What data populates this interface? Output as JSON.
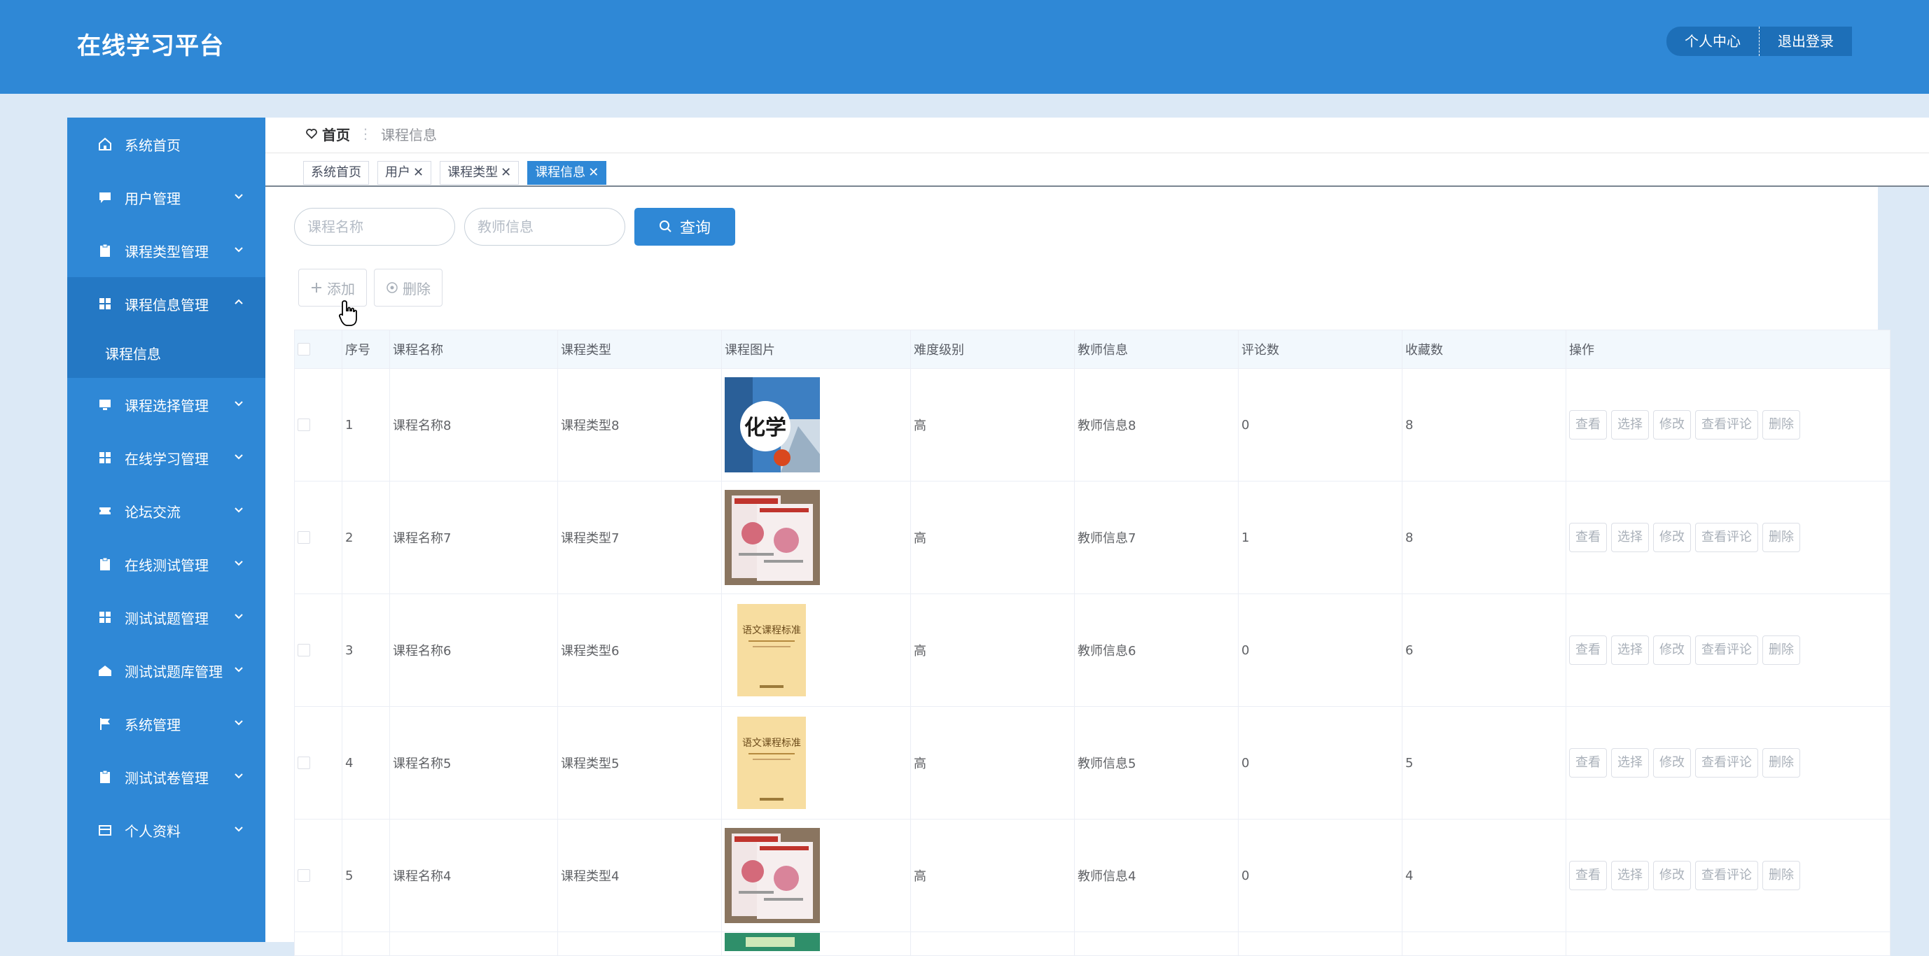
{
  "header": {
    "app_title": "在线学习平台",
    "personal_center": "个人中心",
    "logout": "退出登录"
  },
  "sidebar": {
    "items": [
      {
        "label": "系统首页",
        "icon": "home-icon"
      },
      {
        "label": "用户管理",
        "icon": "chat-icon"
      },
      {
        "label": "课程类型管理",
        "icon": "clipboard-icon"
      },
      {
        "label": "课程信息管理",
        "icon": "grid-icon"
      },
      {
        "label": "课程选择管理",
        "icon": "monitor-icon"
      },
      {
        "label": "在线学习管理",
        "icon": "grid-icon"
      },
      {
        "label": "论坛交流",
        "icon": "ticket-icon"
      },
      {
        "label": "在线测试管理",
        "icon": "clipboard-icon"
      },
      {
        "label": "测试试题管理",
        "icon": "grid-icon"
      },
      {
        "label": "测试试题库管理",
        "icon": "house-icon"
      },
      {
        "label": "系统管理",
        "icon": "flag-icon"
      },
      {
        "label": "测试试卷管理",
        "icon": "clipboard-icon"
      },
      {
        "label": "个人资料",
        "icon": "card-icon"
      }
    ],
    "sub_item": "课程信息"
  },
  "breadcrumb": {
    "home": "首页",
    "current": "课程信息"
  },
  "tabs": [
    {
      "label": "系统首页"
    },
    {
      "label": "用户"
    },
    {
      "label": "课程类型"
    },
    {
      "label": "课程信息"
    }
  ],
  "search": {
    "course_name_placeholder": "课程名称",
    "teacher_placeholder": "教师信息",
    "button": "查询"
  },
  "actions": {
    "add": "添加",
    "delete": "删除"
  },
  "table": {
    "columns": [
      "序号",
      "课程名称",
      "课程类型",
      "课程图片",
      "难度级别",
      "教师信息",
      "评论数",
      "收藏数",
      "操作"
    ],
    "rows": [
      {
        "index": "1",
        "name": "课程名称8",
        "type": "课程类型8",
        "image": "chemistry-cover",
        "level": "高",
        "teacher": "教师信息8",
        "comments": "0",
        "favorites": "8"
      },
      {
        "index": "2",
        "name": "课程名称7",
        "type": "课程类型7",
        "image": "book-set-cover",
        "level": "高",
        "teacher": "教师信息7",
        "comments": "1",
        "favorites": "8"
      },
      {
        "index": "3",
        "name": "课程名称6",
        "type": "课程类型6",
        "image": "chinese-standard-cover",
        "level": "高",
        "teacher": "教师信息6",
        "comments": "0",
        "favorites": "6"
      },
      {
        "index": "4",
        "name": "课程名称5",
        "type": "课程类型5",
        "image": "chinese-standard-cover",
        "level": "高",
        "teacher": "教师信息5",
        "comments": "0",
        "favorites": "5"
      },
      {
        "index": "5",
        "name": "课程名称4",
        "type": "课程类型4",
        "image": "book-set-cover",
        "level": "高",
        "teacher": "教师信息4",
        "comments": "0",
        "favorites": "4"
      }
    ],
    "row_actions": [
      "查看",
      "选择",
      "修改",
      "查看评论",
      "删除"
    ]
  },
  "image_text": {
    "chemistry": "化学",
    "chinese_standard": "语文课程标准"
  }
}
